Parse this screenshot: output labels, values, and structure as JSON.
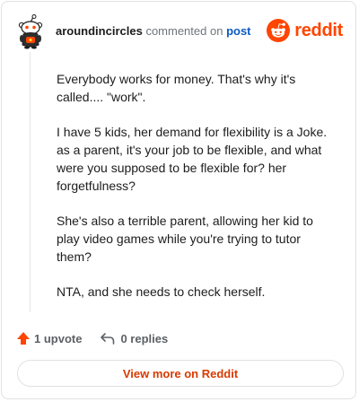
{
  "header": {
    "username": "aroundincircles",
    "action_text": "commented on",
    "post_link": "post",
    "brand_name": "reddit",
    "brand_color": "#ff4500"
  },
  "avatar": {
    "icon": "snoo-avatar-icon"
  },
  "comment": {
    "paragraphs": [
      "Everybody works for money. That's why it's called.... \"work\".",
      "I have 5 kids, her demand for flexibility is a Joke. as a parent, it's your job to be flexible, and what were you supposed to be flexible for? her forgetfulness?",
      "She's also a terrible parent, allowing her kid to play video games while you're trying to tutor them?",
      "NTA, and she needs to check herself."
    ]
  },
  "actions": {
    "upvote_icon": "upvote-arrow-icon",
    "upvote_label": "1 upvote",
    "upvote_color": "#ff4500",
    "reply_icon": "reply-arrow-icon",
    "reply_label": "0 replies"
  },
  "footer": {
    "view_more_label": "View more on Reddit",
    "view_more_color": "#d93a00"
  }
}
